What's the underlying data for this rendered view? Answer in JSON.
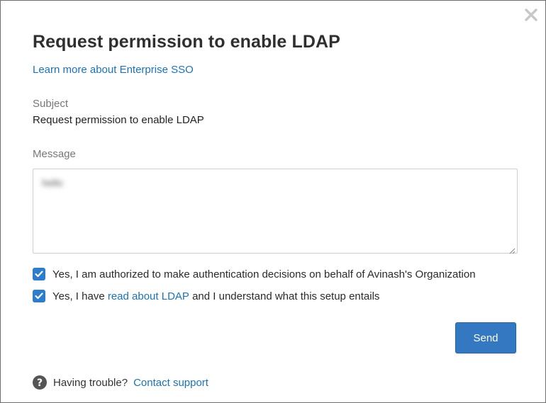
{
  "dialog": {
    "title": "Request permission to enable LDAP",
    "learn_more_link": "Learn more about Enterprise SSO",
    "close_icon": "close-icon"
  },
  "subject": {
    "label": "Subject",
    "value": "Request permission to enable LDAP"
  },
  "message": {
    "label": "Message",
    "value": "hello"
  },
  "checkboxes": [
    {
      "checked": true,
      "text": "Yes, I am authorized to make authentication decisions on behalf of Avinash's Organization"
    },
    {
      "checked": true,
      "text_before": "Yes, I have ",
      "link_text": "read about LDAP",
      "text_after": " and I understand what this setup entails"
    }
  ],
  "send_button": {
    "label": "Send"
  },
  "footer": {
    "help_icon": "question-circle-icon",
    "text": "Having trouble?",
    "link_text": "Contact support"
  },
  "colors": {
    "accent": "#3478c1",
    "link": "#1a73b8",
    "checkbox": "#2c7dcc"
  }
}
